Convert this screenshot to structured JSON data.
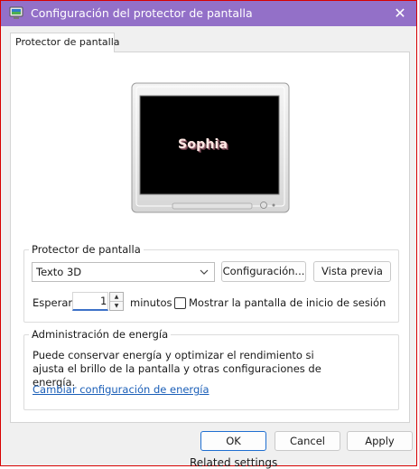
{
  "window": {
    "title": "Configuración del protector de pantalla",
    "close_glyph": "✕"
  },
  "tab": {
    "label": "Protector de pantalla"
  },
  "preview": {
    "text": "Sophia"
  },
  "screensaver_group": {
    "legend": "Protector de pantalla",
    "selected": "Texto 3D",
    "settings_button": "Configuración...",
    "preview_button": "Vista previa",
    "wait_label": "Esperar:",
    "wait_value": "1",
    "minutes_label": "minutos",
    "resume_checkbox_label": "Mostrar la pantalla de inicio de sesión al re",
    "resume_checked": false
  },
  "power_group": {
    "legend": "Administración de energía",
    "description": "Puede conservar energía y optimizar el rendimiento si ajusta el brillo de la pantalla y otras configuraciones de energía.",
    "link": "Cambiar configuración de energía"
  },
  "footer": {
    "ok": "OK",
    "cancel": "Cancel",
    "apply": "Apply"
  },
  "behind_window": {
    "text": "Related settings"
  },
  "colors": {
    "titlebar": "#9370c8",
    "frame_border": "#d80000",
    "link": "#1b5fb8",
    "focus": "#1f6fd1"
  },
  "icons": [
    "screensaver-app-icon",
    "close-icon",
    "chevron-down-icon",
    "spin-up-icon",
    "spin-down-icon",
    "monitor-preview"
  ]
}
